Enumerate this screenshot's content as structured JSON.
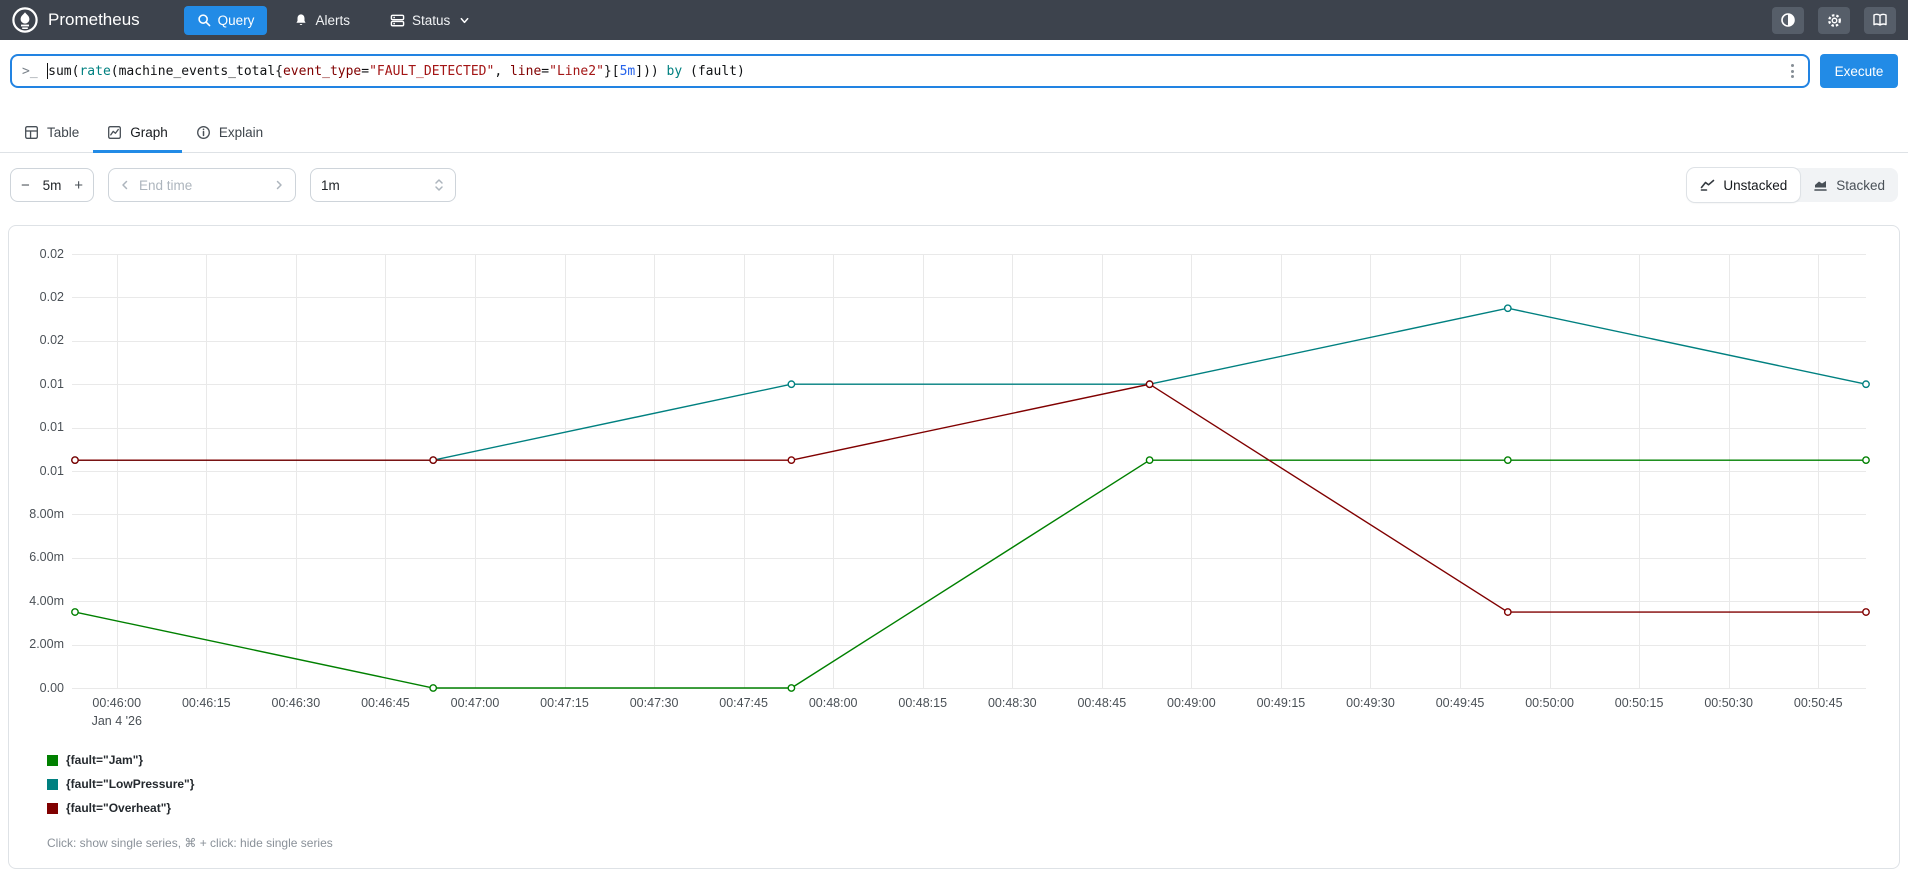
{
  "navbar": {
    "brand": "Prometheus",
    "nav": [
      {
        "label": "Query",
        "icon": "search-icon",
        "active": true
      },
      {
        "label": "Alerts",
        "icon": "bell-icon",
        "active": false
      },
      {
        "label": "Status",
        "icon": "server-icon",
        "active": false,
        "has_chevron": true
      }
    ],
    "action_icons": [
      "contrast-icon",
      "gear-icon",
      "book-icon"
    ]
  },
  "query_bar": {
    "expression": "sum(rate(machine_events_total{event_type=\"FAULT_DETECTED\", line=\"Line2\"}[5m])) by (fault)",
    "tokens": [
      {
        "t": "sum",
        "c": "agg"
      },
      {
        "t": "(",
        "c": "p"
      },
      {
        "t": "rate",
        "c": "fn"
      },
      {
        "t": "(",
        "c": "p"
      },
      {
        "t": "machine_events_total",
        "c": "metric"
      },
      {
        "t": "{",
        "c": "p"
      },
      {
        "t": "event_type",
        "c": "label"
      },
      {
        "t": "=",
        "c": "p"
      },
      {
        "t": "\"FAULT_DETECTED\"",
        "c": "str"
      },
      {
        "t": ", ",
        "c": "p"
      },
      {
        "t": "line",
        "c": "label"
      },
      {
        "t": "=",
        "c": "p"
      },
      {
        "t": "\"Line2\"",
        "c": "str"
      },
      {
        "t": "}",
        "c": "p"
      },
      {
        "t": "[",
        "c": "p"
      },
      {
        "t": "5m",
        "c": "dur"
      },
      {
        "t": "]",
        "c": "p"
      },
      {
        "t": ")) ",
        "c": "p"
      },
      {
        "t": "by",
        "c": "kw"
      },
      {
        "t": " (fault)",
        "c": "p"
      }
    ],
    "token_colors": {
      "agg": "#101214",
      "fn": "#008080",
      "kw": "#008080",
      "metric": "#101214",
      "label": "#800000",
      "str": "#a31515",
      "dur": "#2563eb",
      "p": "#101214"
    },
    "execute_label": "Execute"
  },
  "tabs": [
    {
      "label": "Table",
      "icon": "table-icon",
      "active": false
    },
    {
      "label": "Graph",
      "icon": "graph-icon",
      "active": true
    },
    {
      "label": "Explain",
      "icon": "info-icon",
      "active": false
    }
  ],
  "controls": {
    "range": {
      "decrease": "−",
      "value": "5m",
      "increase": "+"
    },
    "end_time_placeholder": "End time",
    "resolution_value": "1m",
    "stacking": [
      {
        "label": "Unstacked",
        "icon": "line-chart-icon",
        "active": true
      },
      {
        "label": "Stacked",
        "icon": "stacked-area-icon",
        "active": false
      }
    ]
  },
  "chart_data": {
    "type": "line",
    "title": "",
    "x_unit": "seconds since 00:00:00, Jan 4 '26",
    "x_min": 2752.5,
    "x_max": 3053,
    "y_min": 0,
    "y_max": 0.02,
    "grid": true,
    "legend_position": "bottom-left",
    "y_ticks": [
      {
        "v": 0.02,
        "label": "0.02"
      },
      {
        "v": 0.018,
        "label": "0.02"
      },
      {
        "v": 0.016,
        "label": "0.02"
      },
      {
        "v": 0.014,
        "label": "0.01"
      },
      {
        "v": 0.012,
        "label": "0.01"
      },
      {
        "v": 0.01,
        "label": "0.01"
      },
      {
        "v": 0.008,
        "label": "8.00m"
      },
      {
        "v": 0.006,
        "label": "6.00m"
      },
      {
        "v": 0.004,
        "label": "4.00m"
      },
      {
        "v": 0.002,
        "label": "2.00m"
      },
      {
        "v": 0.0,
        "label": "0.00"
      }
    ],
    "x_ticks": [
      {
        "t": 2760,
        "label": "00:46:00",
        "sub": "Jan 4 '26"
      },
      {
        "t": 2775,
        "label": "00:46:15"
      },
      {
        "t": 2790,
        "label": "00:46:30"
      },
      {
        "t": 2805,
        "label": "00:46:45"
      },
      {
        "t": 2820,
        "label": "00:47:00"
      },
      {
        "t": 2835,
        "label": "00:47:15"
      },
      {
        "t": 2850,
        "label": "00:47:30"
      },
      {
        "t": 2865,
        "label": "00:47:45"
      },
      {
        "t": 2880,
        "label": "00:48:00"
      },
      {
        "t": 2895,
        "label": "00:48:15"
      },
      {
        "t": 2910,
        "label": "00:48:30"
      },
      {
        "t": 2925,
        "label": "00:48:45"
      },
      {
        "t": 2940,
        "label": "00:49:00"
      },
      {
        "t": 2955,
        "label": "00:49:15"
      },
      {
        "t": 2970,
        "label": "00:49:30"
      },
      {
        "t": 2985,
        "label": "00:49:45"
      },
      {
        "t": 3000,
        "label": "00:50:00"
      },
      {
        "t": 3015,
        "label": "00:50:15"
      },
      {
        "t": 3030,
        "label": "00:50:30"
      },
      {
        "t": 3045,
        "label": "00:50:45"
      }
    ],
    "series": [
      {
        "name": "{fault=\"Jam\"}",
        "color": "#008000",
        "points": [
          [
            2753,
            0.0035
          ],
          [
            2813,
            0
          ],
          [
            2873,
            0
          ],
          [
            2933,
            0.0105
          ],
          [
            2993,
            0.0105
          ],
          [
            3053,
            0.0105
          ]
        ]
      },
      {
        "name": "{fault=\"LowPressure\"}",
        "color": "#008080",
        "points": [
          [
            2753,
            0.0105
          ],
          [
            2813,
            0.0105
          ],
          [
            2873,
            0.014
          ],
          [
            2933,
            0.014
          ],
          [
            2993,
            0.0175
          ],
          [
            3053,
            0.014
          ]
        ]
      },
      {
        "name": "{fault=\"Overheat\"}",
        "color": "#800000",
        "points": [
          [
            2753,
            0.0105
          ],
          [
            2813,
            0.0105
          ],
          [
            2873,
            0.0105
          ],
          [
            2933,
            0.014
          ],
          [
            2993,
            0.0035
          ],
          [
            3053,
            0.0035
          ]
        ]
      }
    ]
  },
  "legend_hint": "Click: show single series, ⌘ + click: hide single series",
  "colors": {
    "accent_blue": "#228be6",
    "navbar_bg": "#3d434d",
    "grid_line": "#e9e9e9",
    "panel_border": "#dee2e6"
  }
}
